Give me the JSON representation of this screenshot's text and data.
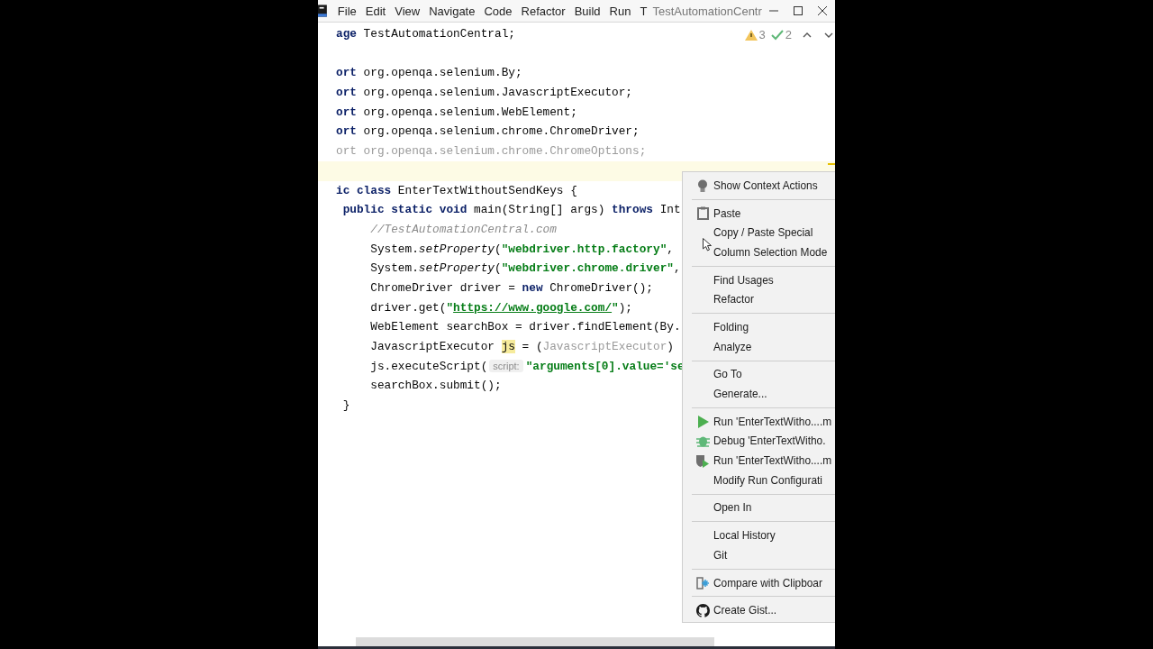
{
  "menu_bar": {
    "items": [
      "File",
      "Edit",
      "View",
      "Navigate",
      "Code",
      "Refactor",
      "Build",
      "Run",
      "T"
    ],
    "title": "TestAutomationCentr"
  },
  "inspections": {
    "warnings": "3",
    "typos": "2"
  },
  "editor": {
    "lines": [
      {
        "current": false,
        "tokens": [
          {
            "kind": "kw",
            "text": "age"
          },
          {
            "kind": "plain",
            "text": " TestAutomationCentral;"
          }
        ]
      },
      {
        "current": false
      },
      {
        "current": false,
        "tokens": [
          {
            "kind": "kw",
            "text": "ort"
          },
          {
            "kind": "plain",
            "text": " org.openqa.selenium.By;"
          }
        ]
      },
      {
        "current": false,
        "tokens": [
          {
            "kind": "kw",
            "text": "ort"
          },
          {
            "kind": "plain",
            "text": " org.openqa.selenium.JavascriptExecutor;"
          }
        ]
      },
      {
        "current": false,
        "tokens": [
          {
            "kind": "kw",
            "text": "ort"
          },
          {
            "kind": "plain",
            "text": " org.openqa.selenium.WebElement;"
          }
        ]
      },
      {
        "current": false,
        "tokens": [
          {
            "kind": "kw",
            "text": "ort"
          },
          {
            "kind": "plain",
            "text": " org.openqa.selenium.chrome.ChromeDriver;"
          }
        ]
      },
      {
        "current": false,
        "tokens": [
          {
            "kind": "dim",
            "text": "ort org.openqa.selenium.chrome.ChromeOptions;"
          }
        ]
      },
      {
        "current": true
      },
      {
        "current": false,
        "tokens": [
          {
            "kind": "kw",
            "text": "ic class"
          },
          {
            "kind": "plain",
            "text": " EnterTextWithoutSendKeys {"
          }
        ]
      },
      {
        "current": false,
        "tokens": [
          {
            "kind": "kw",
            "text": " public static void"
          },
          {
            "kind": "plain",
            "text": " main(String[] args) "
          },
          {
            "kind": "kw",
            "text": "throws"
          },
          {
            "kind": "plain",
            "text": " Int"
          }
        ]
      },
      {
        "current": false,
        "tokens": [
          {
            "kind": "comment",
            "text": "     //TestAutomationCentral.com"
          }
        ]
      },
      {
        "current": false,
        "tokens": [
          {
            "kind": "plain",
            "text": "     System."
          },
          {
            "kind": "italic",
            "text": "setProperty"
          },
          {
            "kind": "plain",
            "text": "("
          },
          {
            "kind": "str",
            "text": "\"webdriver.http.factory\""
          },
          {
            "kind": "plain",
            "text": ","
          }
        ]
      },
      {
        "current": false,
        "tokens": [
          {
            "kind": "plain",
            "text": "     System."
          },
          {
            "kind": "italic",
            "text": "setProperty"
          },
          {
            "kind": "plain",
            "text": "("
          },
          {
            "kind": "str",
            "text": "\"webdriver.chrome.driver\""
          },
          {
            "kind": "plain",
            "text": ","
          }
        ]
      },
      {
        "current": false,
        "tokens": [
          {
            "kind": "plain",
            "text": "     ChromeDriver driver = "
          },
          {
            "kind": "kw",
            "text": "new"
          },
          {
            "kind": "plain",
            "text": " ChromeDriver();"
          }
        ]
      },
      {
        "current": false,
        "tokens": [
          {
            "kind": "plain",
            "text": "     driver.get("
          },
          {
            "kind": "str",
            "text": "\""
          },
          {
            "kind": "url",
            "text": "https://www.google.com/"
          },
          {
            "kind": "str",
            "text": "\""
          },
          {
            "kind": "plain",
            "text": ");"
          }
        ]
      },
      {
        "current": false,
        "tokens": [
          {
            "kind": "plain",
            "text": "     WebElement searchBox = driver.findElement(By."
          }
        ]
      },
      {
        "current": false,
        "tokens": [
          {
            "kind": "plain",
            "text": "     JavascriptExecutor "
          },
          {
            "kind": "mark",
            "text": "js"
          },
          {
            "kind": "plain",
            "text": " = ("
          },
          {
            "kind": "dim",
            "text": "JavascriptExecutor"
          },
          {
            "kind": "plain",
            "text": ")"
          }
        ]
      },
      {
        "current": false,
        "tokens": [
          {
            "kind": "plain",
            "text": "     js.executeScript("
          },
          {
            "kind": "hint",
            "text": "script:"
          },
          {
            "kind": "str",
            "text": "\"arguments[0].value='se"
          }
        ]
      },
      {
        "current": false,
        "tokens": [
          {
            "kind": "plain",
            "text": "     searchBox.submit();"
          }
        ]
      },
      {
        "current": false,
        "tokens": [
          {
            "kind": "plain",
            "text": " }"
          }
        ]
      }
    ]
  },
  "context_menu": {
    "groups": [
      [
        {
          "label": "Show Context Actions",
          "kind": "bulb"
        }
      ],
      [
        {
          "label": "Paste",
          "kind": "paste"
        },
        {
          "label": "Copy / Paste Special"
        },
        {
          "label": "Column Selection Mode"
        }
      ],
      [
        {
          "label": "Find Usages"
        },
        {
          "label": "Refactor"
        }
      ],
      [
        {
          "label": "Folding"
        },
        {
          "label": "Analyze"
        }
      ],
      [
        {
          "label": "Go To"
        },
        {
          "label": "Generate..."
        }
      ],
      [
        {
          "label": "Run 'EnterTextWitho....m",
          "kind": "run"
        },
        {
          "label": "Debug 'EnterTextWitho.",
          "kind": "debug"
        },
        {
          "label": "Run 'EnterTextWitho....m",
          "kind": "coverage"
        },
        {
          "label": "Modify Run Configurati"
        }
      ],
      [
        {
          "label": "Open In"
        }
      ],
      [
        {
          "label": "Local History"
        },
        {
          "label": "Git"
        }
      ],
      [
        {
          "label": "Compare with Clipboar",
          "kind": "compare"
        }
      ],
      [
        {
          "label": "Create Gist...",
          "kind": "github"
        }
      ]
    ]
  }
}
